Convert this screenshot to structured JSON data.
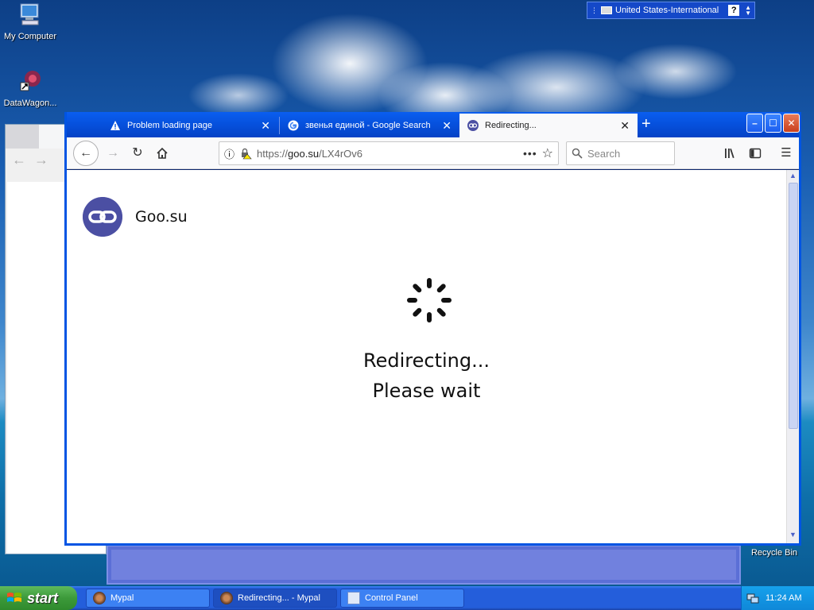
{
  "desktop": {
    "icons": [
      {
        "label": "My Computer"
      },
      {
        "label": "DataWagon..."
      },
      {
        "label": "Recycle Bin"
      }
    ]
  },
  "langbar": {
    "language": "United States-International",
    "help": "?"
  },
  "browser": {
    "tabs": [
      {
        "title": "Problem loading page",
        "icon": "warning-icon"
      },
      {
        "title": "звенья единой - Google Search",
        "icon": "google-icon"
      },
      {
        "title": "Redirecting...",
        "icon": "goo-su-link-icon"
      }
    ],
    "new_tab": "+",
    "url": {
      "scheme": "https://",
      "host": "goo.su",
      "path": "/LX4rOv6"
    },
    "search_placeholder": "Search"
  },
  "page": {
    "site_name": "Goo.su",
    "message_line1": "Redirecting...",
    "message_line2": "Please wait",
    "logo_color": "#4b4fa3"
  },
  "taskbar": {
    "start_label": "start",
    "tasks": [
      {
        "label": "Mypal"
      },
      {
        "label": "Redirecting... - Mypal"
      },
      {
        "label": "Control Panel"
      }
    ],
    "clock": "11:24 AM"
  }
}
